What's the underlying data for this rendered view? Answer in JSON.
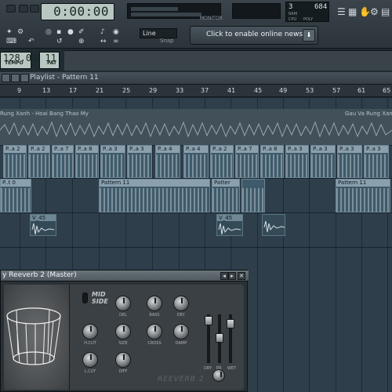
{
  "toolbar": {
    "song_time": "0:00:00",
    "meter_label": "MONITOR",
    "cpu_value": "3",
    "ram_value": "684",
    "ram_label": "RAM",
    "cpu_label": "CPU",
    "poly_label": "POLY",
    "snap_value": "Line",
    "snap_label": "Snap",
    "news_text": "Click to enable online news",
    "tempo_value": "128.000",
    "tempo_label": "TEMPO",
    "pattern_value": "11",
    "pattern_label": "PAT"
  },
  "playlist": {
    "title": "Playlist - Pattern 11",
    "bar_numbers": [
      "9",
      "13",
      "17",
      "21",
      "25",
      "29",
      "33",
      "37",
      "41",
      "45",
      "49",
      "53",
      "57",
      "61",
      "65"
    ],
    "audio_clip_left": "Rung Xanh - Hoai Bang Thao My",
    "audio_clip_right": "Gau Va Rung Xanh",
    "clip_row1": [
      "P..a 2",
      "P..a 7",
      "P..a 8",
      "P..a 3",
      "P..a 3",
      "P..a 4",
      "P..a 4",
      "P..a 2",
      "P..a 7",
      "P..a 8",
      "P..a 3",
      "P..a 3"
    ],
    "clip_row2": [
      "P..t 0",
      "Pattern 11",
      "Patter",
      "Pattern 11"
    ],
    "sample_label": "V_45"
  },
  "plugin": {
    "title": "y Reeverb 2 (Master)",
    "mid_side_label": "MID\nSIDE",
    "knob_labels": [
      "DEL",
      "BASS",
      "DEC",
      "H.CUT",
      "SIZE",
      "CROSS",
      "DAMP",
      "L.CUT",
      "DIFF"
    ],
    "fader_labels": [
      "DRY",
      "ER",
      "WET"
    ],
    "brand": "REEVERB 2"
  }
}
